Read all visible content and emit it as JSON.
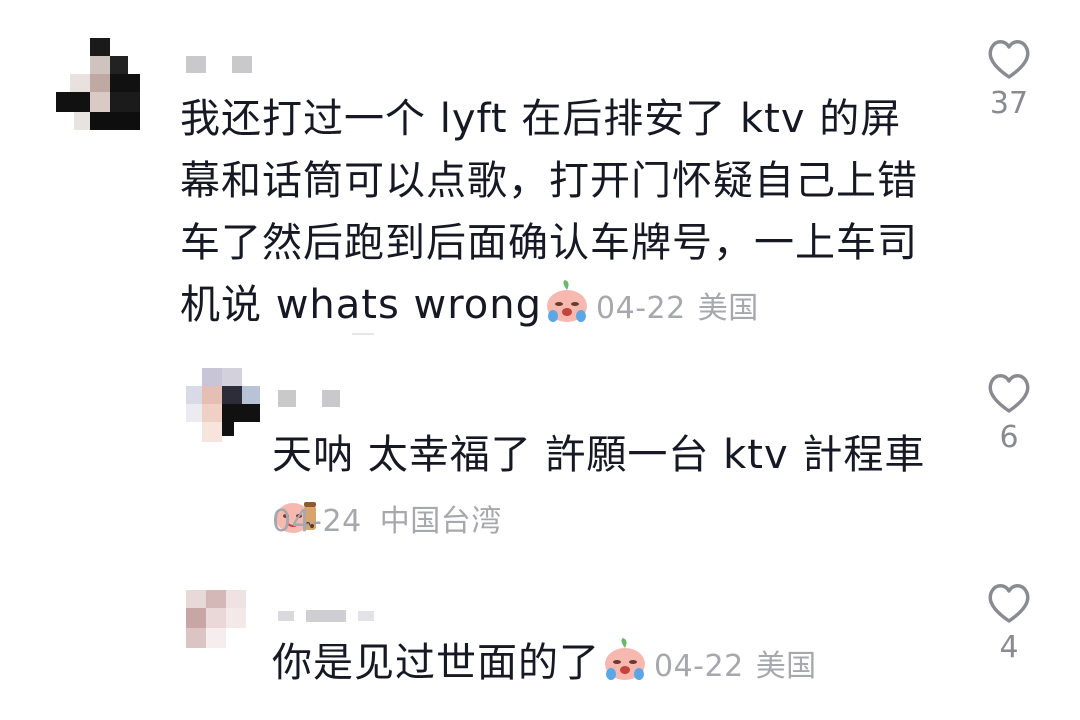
{
  "comments": [
    {
      "text": "我还打过一个 lyft 在后排安了 ktv 的屏幕和话筒可以点歌，打开门怀疑自己上错车了然后跑到后面确认车牌号，一上车司机说 whats wrong",
      "emoji": "crying-peach-emoji",
      "date": "04-22",
      "location": "美国",
      "likes": "37"
    },
    {
      "text": "天呐 太幸福了 許願一台 ktv 計程車",
      "emoji": "peach-bubble-tea-emoji",
      "date": "04-24",
      "location": "中国台湾",
      "likes": "6"
    },
    {
      "text": "你是见过世面的了",
      "emoji": "crying-peach-emoji",
      "date": "04-22",
      "location": "美国",
      "likes": "4"
    }
  ],
  "colors": {
    "text": "#161823",
    "meta": "#a7a8ad",
    "like_icon": "#8a8b91"
  }
}
